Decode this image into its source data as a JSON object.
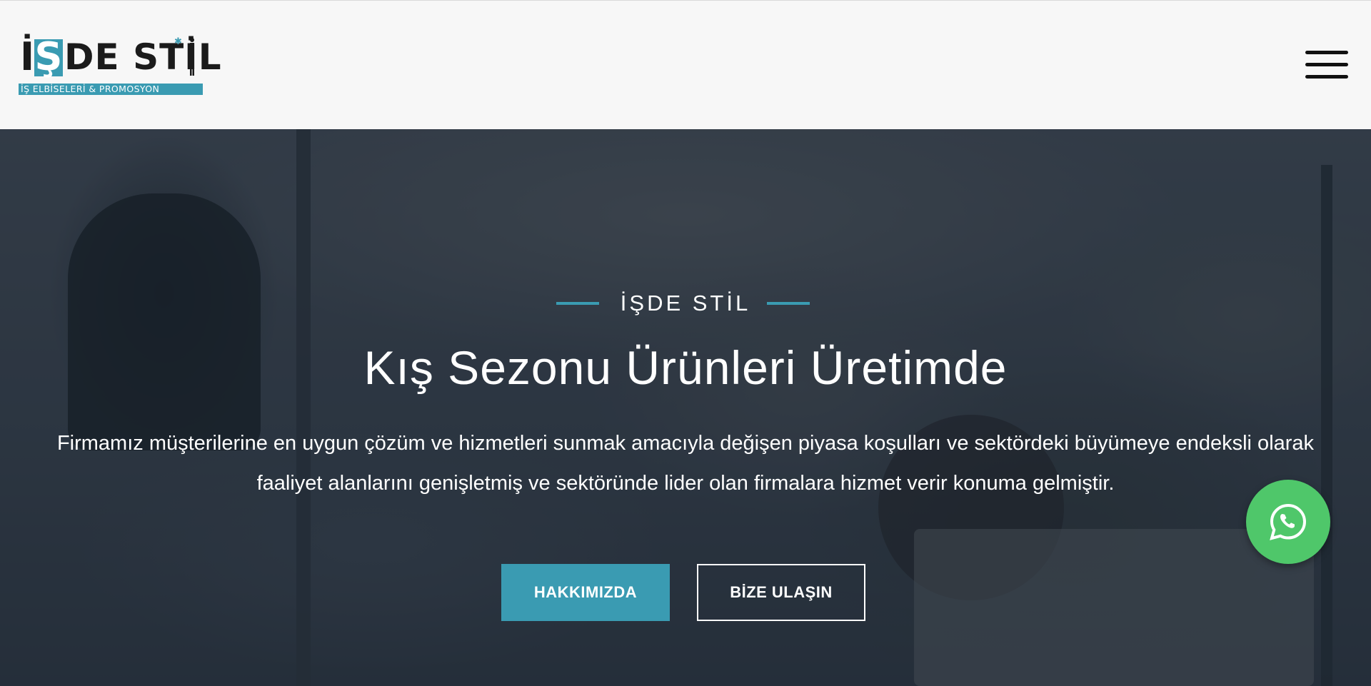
{
  "brand": {
    "logo_main": "DE STİL",
    "logo_letter_i": "İ",
    "logo_letter_s": "Ş",
    "logo_tagline": "İŞ ELBİSELERİ & PROMOSYON"
  },
  "header": {
    "menu_icon": "hamburger-menu-icon"
  },
  "hero": {
    "eyebrow": "İŞDE STİL",
    "title": "Kış Sezonu Ürünleri Üretimde",
    "description": "Firmamız müşterilerine en uygun çözüm ve hizmetleri sunmak amacıyla  değişen piyasa koşulları ve sektördeki büyümeye endeksli olarak faaliyet alanlarını genişletmiş ve sektöründe lider olan firmalara hizmet verir konuma gelmiştir.",
    "primary_button": "HAKKIMIZDA",
    "secondary_button": "BİZE ULAŞIN"
  },
  "floating": {
    "whatsapp_icon": "whatsapp-icon"
  },
  "colors": {
    "accent": "#3a9bb2",
    "whatsapp": "#4fc76a",
    "header_bg": "#f7f7f7"
  }
}
